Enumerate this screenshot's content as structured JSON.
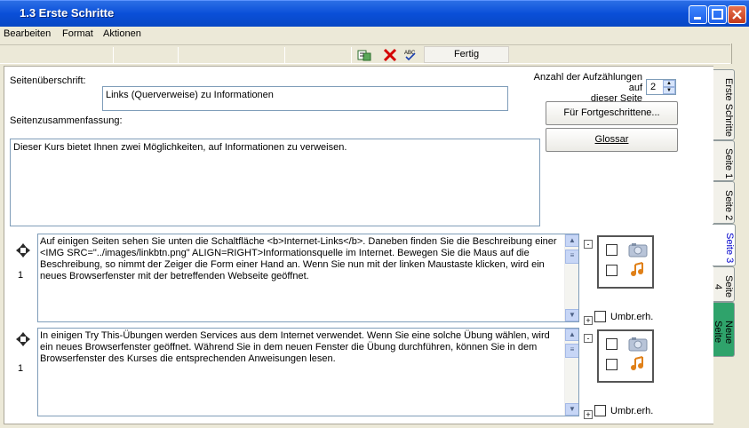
{
  "window": {
    "title": "1.3 Erste Schritte"
  },
  "menu": [
    "Bearbeiten",
    "Format",
    "Aktionen"
  ],
  "toolbar": {
    "done_label": "Fertig"
  },
  "form": {
    "heading_label": "Seitenüberschrift:",
    "heading_value": "Links (Querverweise) zu Informationen",
    "summary_label": "Seitenzusammenfassung:",
    "summary_value": "Dieser Kurs bietet Ihnen zwei Möglichkeiten, auf Informationen zu verweisen.",
    "bullet_count_label_1": "Anzahl der Aufzählungen auf",
    "bullet_count_label_2": "dieser Seite",
    "bullet_count_value": "2",
    "advanced_button": "Für Fortgeschrittene...",
    "glossary_button": "Glossar"
  },
  "bullets": [
    {
      "number": "1",
      "text": "Auf einigen Seiten sehen Sie unten die Schaltfläche <b>Internet-Links</b>. Daneben finden Sie die Beschreibung einer <IMG SRC=\"../images/linkbtn.png\" ALIGN=RIGHT>Informationsquelle im Internet. Bewegen Sie die Maus auf die Beschreibung, so nimmt der Zeiger die Form einer Hand an. Wenn Sie nun mit der linken Maustaste klicken, wird ein neues Browserfenster mit der betreffenden Webseite geöffnet.",
      "wrap_label": "Umbr.erh."
    },
    {
      "number": "1",
      "text": "In einigen Try This-Übungen werden Services aus dem Internet verwendet. Wenn Sie eine solche Übung wählen, wird ein neues Browserfenster geöffnet. Während Sie in dem neuen Fenster die Übung durchführen, können Sie in dem Browserfenster des Kurses die entsprechenden Anweisungen lesen.",
      "wrap_label": "Umbr.erh."
    }
  ],
  "tabs": [
    "Erste Schritte",
    "Seite 1",
    "Seite 2",
    "Seite 3",
    "Seite 4",
    "Neue Seite"
  ],
  "colors": {
    "title_bar": "#0a4fd8",
    "active_tab_text": "#0000cc",
    "new_page_tab": "#2fa36b"
  }
}
